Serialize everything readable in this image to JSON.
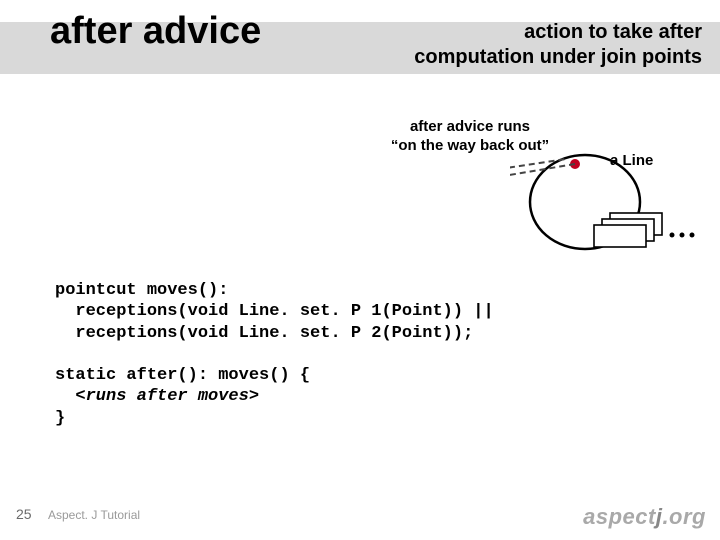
{
  "header": {
    "title": "after advice",
    "subtitle_line1": "action to take after",
    "subtitle_line2": "computation under join points"
  },
  "diagram": {
    "caption_line1": "after advice runs",
    "caption_line2": "“on the way back out”",
    "object_label": "a Line"
  },
  "code": {
    "line1_kw": "pointcut",
    "line1_rest": " moves():",
    "line2": "  receptions(void Line. set. P 1(Point)) ||",
    "line3": "  receptions(void Line. set. P 2(Point));",
    "line5_a": "static after",
    "line5_b": "(): moves() {",
    "line6_ital": "  <runs after moves>",
    "line7": "}"
  },
  "footer": {
    "page_number": "25",
    "tutorial": "Aspect. J Tutorial",
    "logo_a": "aspect",
    "logo_b": "j",
    "logo_c": ".org"
  }
}
